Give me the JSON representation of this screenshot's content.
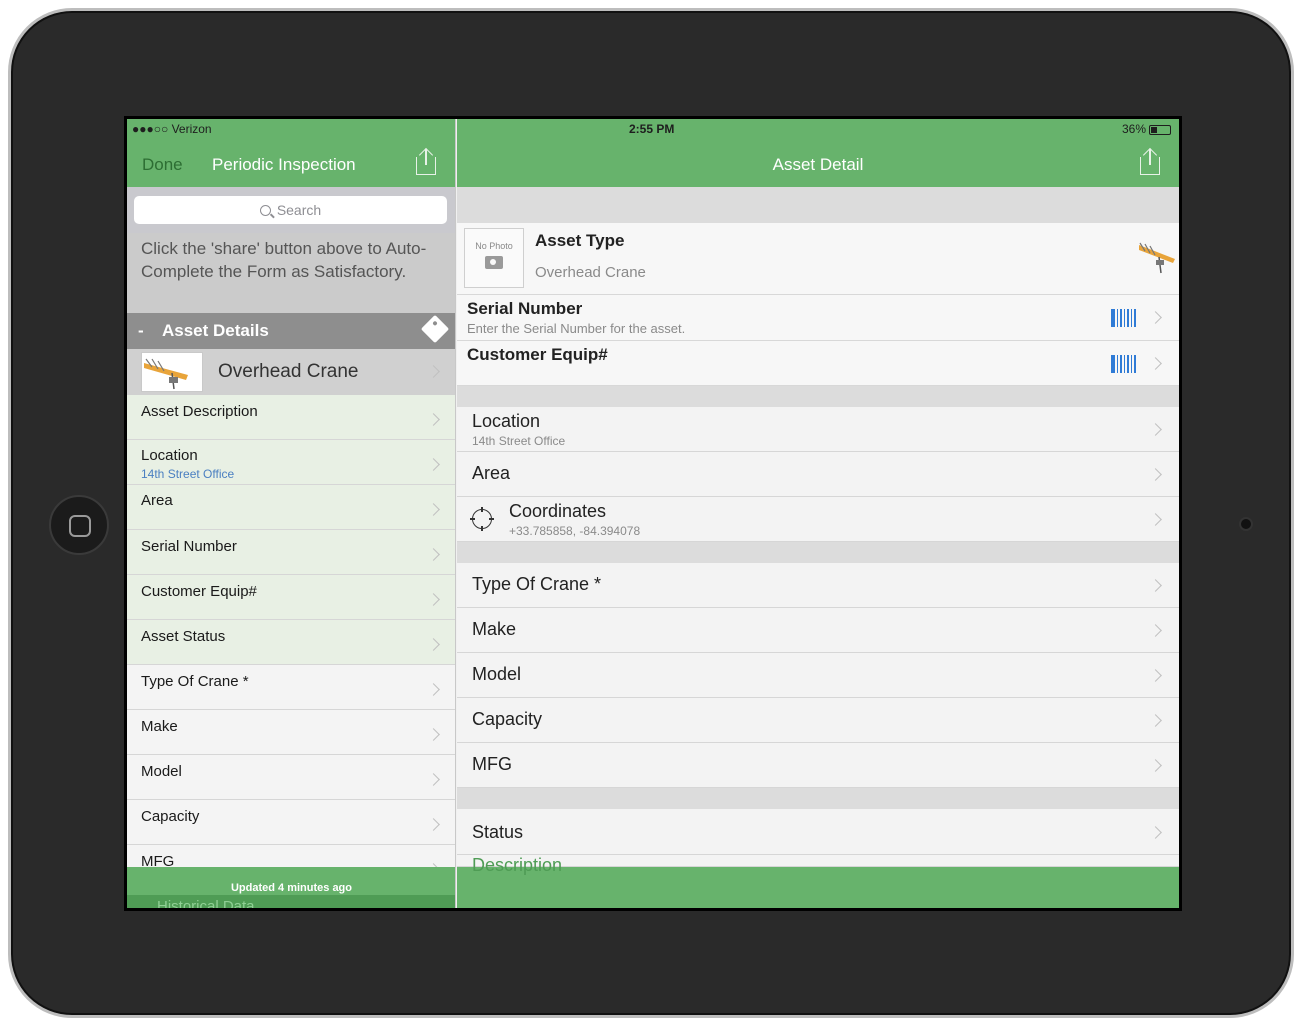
{
  "status_bar": {
    "carrier": "●●●○○ Verizon",
    "time": "2:55 PM",
    "battery": "36%"
  },
  "master": {
    "nav": {
      "done_label": "Done",
      "title": "Periodic Inspection"
    },
    "search": {
      "placeholder": "Search"
    },
    "hint": "Click the 'share' button above to Auto-Complete the Form as Satisfactory.",
    "section": {
      "toggle": "-",
      "title": "Asset Details"
    },
    "asset": {
      "name": "Overhead Crane"
    },
    "rows": [
      {
        "label": "Asset Description",
        "sub": ""
      },
      {
        "label": "Location",
        "sub": "14th Street Office"
      },
      {
        "label": "Area",
        "sub": ""
      },
      {
        "label": "Serial Number",
        "sub": ""
      },
      {
        "label": "Customer Equip#",
        "sub": ""
      },
      {
        "label": "Asset Status",
        "sub": ""
      },
      {
        "label": "Type Of Crane *",
        "sub": ""
      },
      {
        "label": "Make",
        "sub": ""
      },
      {
        "label": "Model",
        "sub": ""
      },
      {
        "label": "Capacity",
        "sub": ""
      },
      {
        "label": "MFG",
        "sub": ""
      }
    ],
    "footer": {
      "updated": "Updated 4 minutes ago",
      "historical": "Historical Data"
    }
  },
  "detail": {
    "nav": {
      "title": "Asset Detail"
    },
    "asset_type": {
      "photo_label": "No Photo",
      "label": "Asset Type",
      "value": "Overhead Crane"
    },
    "serial_number": {
      "label": "Serial Number",
      "placeholder": "Enter the Serial Number for the asset."
    },
    "customer_equip": {
      "label": "Customer Equip#"
    },
    "location": {
      "label": "Location",
      "value": "14th Street Office"
    },
    "area": {
      "label": "Area"
    },
    "coordinates": {
      "label": "Coordinates",
      "value": "+33.785858, -84.394078"
    },
    "spec_rows": [
      "Type Of Crane *",
      "Make",
      "Model",
      "Capacity",
      "MFG"
    ],
    "status": {
      "label": "Status"
    },
    "description": {
      "label": "Description"
    }
  },
  "colors": {
    "nav_green": "#67b36c",
    "barcode_blue": "#2f7bd6",
    "subtitle_blue": "#4a7fc1"
  }
}
